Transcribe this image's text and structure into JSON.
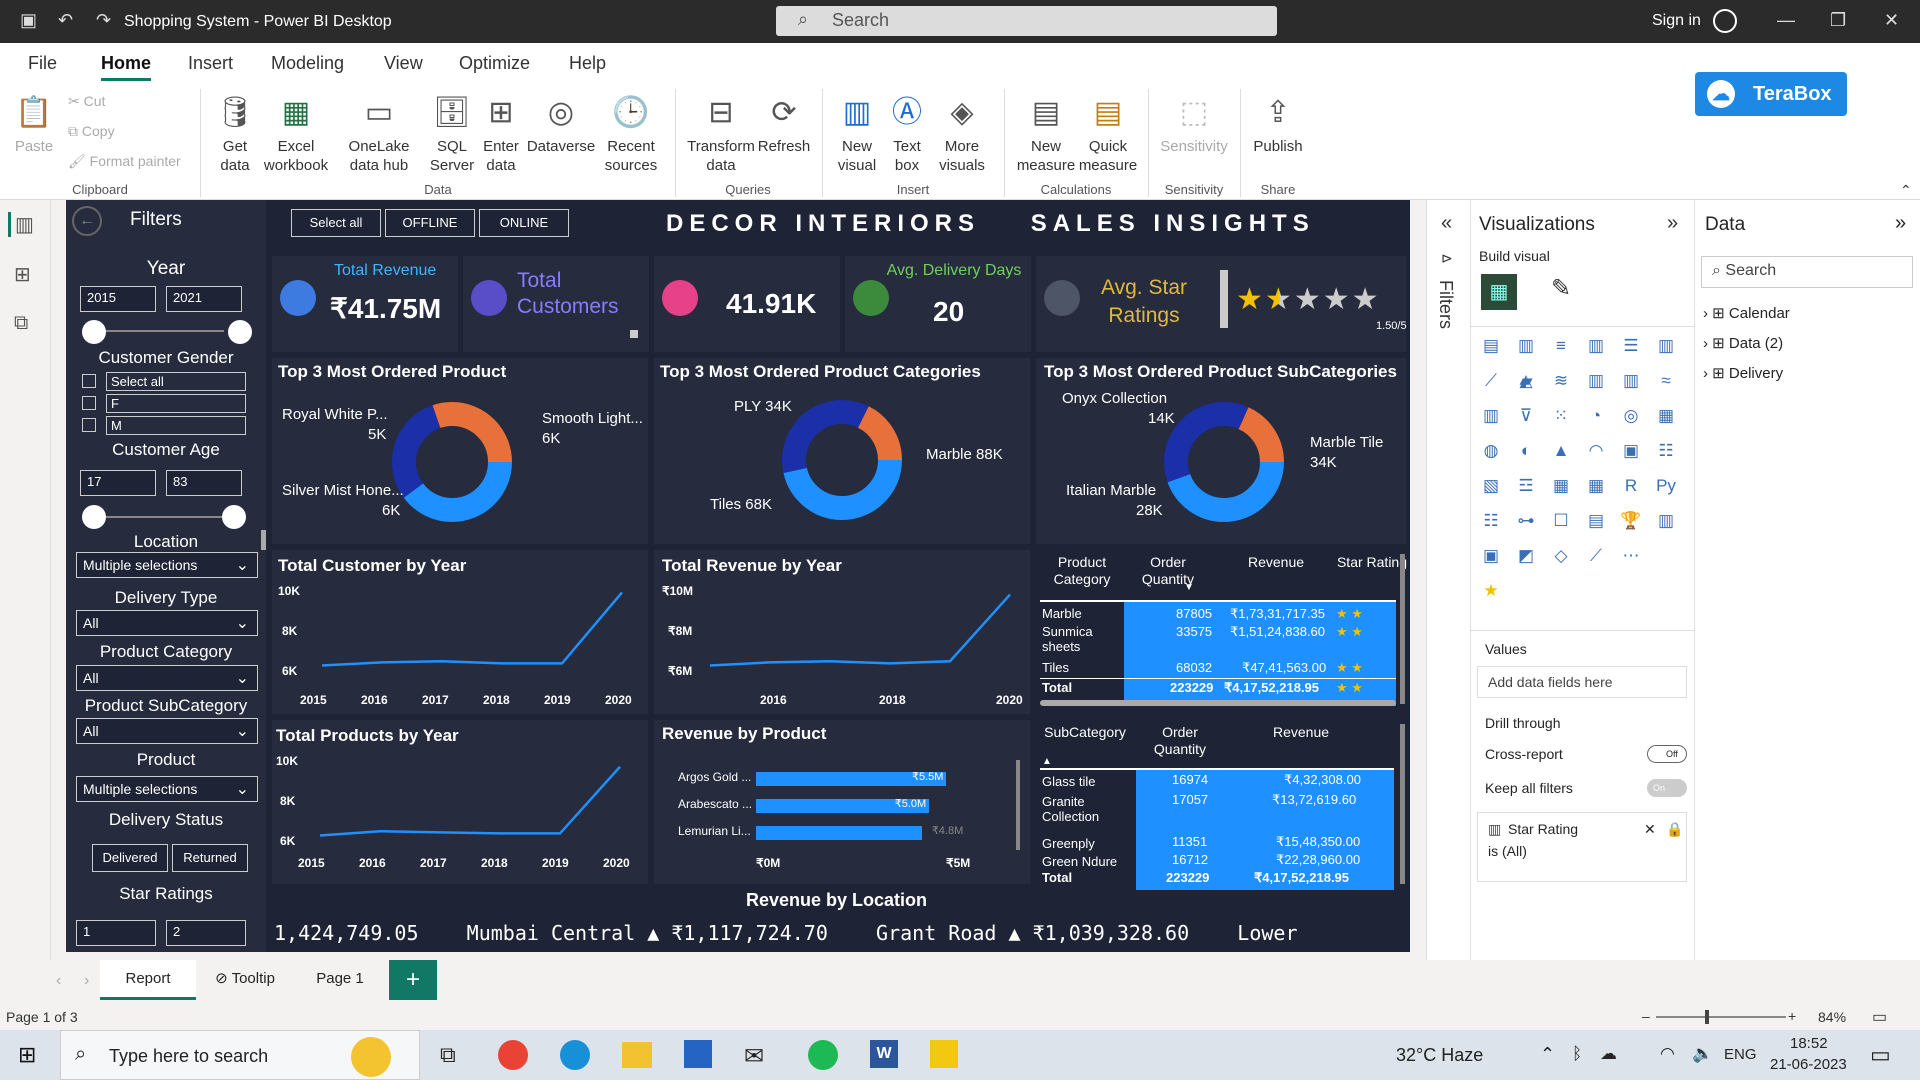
{
  "titlebar": {
    "title": "Shopping System - Power BI Desktop",
    "search_placeholder": "Search",
    "signin": "Sign in"
  },
  "menu": [
    "File",
    "Home",
    "Insert",
    "Modeling",
    "View",
    "Optimize",
    "Help"
  ],
  "ribbon": {
    "clipboard": {
      "paste": "Paste",
      "cut": "Cut",
      "copy": "Copy",
      "format_painter": "Format painter",
      "group": "Clipboard"
    },
    "data": {
      "get_data": "Get data",
      "excel": "Excel workbook",
      "onelake": "OneLake data hub",
      "sql": "SQL Server",
      "enter": "Enter data",
      "dataverse": "Dataverse",
      "recent": "Recent sources",
      "group": "Data"
    },
    "queries": {
      "transform": "Transform data",
      "refresh": "Refresh",
      "group": "Queries"
    },
    "insert": {
      "new_visual": "New visual",
      "text_box": "Text box",
      "more_visuals": "More visuals",
      "group": "Insert"
    },
    "calculations": {
      "new_measure": "New measure",
      "quick_measure": "Quick measure",
      "group": "Calculations"
    },
    "sensitivity": {
      "label": "Sensitivity",
      "group": "Sensitivity"
    },
    "share": {
      "publish": "Publish",
      "group": "Share"
    },
    "terabox": "TeraBox"
  },
  "report": {
    "filters_title": "Filters",
    "buttons": [
      "Select all",
      "OFFLINE",
      "ONLINE"
    ],
    "heading": "DECOR INTERIORS    SALES INSIGHTS",
    "slicers": {
      "year": {
        "label": "Year",
        "from": "2015",
        "to": "2021"
      },
      "gender": {
        "label": "Customer Gender",
        "options": [
          "Select all",
          "F",
          "M"
        ]
      },
      "age": {
        "label": "Customer Age",
        "from": "17",
        "to": "83"
      },
      "location": {
        "label": "Location",
        "value": "Multiple selections"
      },
      "delivery_type": {
        "label": "Delivery Type",
        "value": "All"
      },
      "product_category": {
        "label": "Product Category",
        "value": "All"
      },
      "product_subcategory": {
        "label": "Product SubCategory",
        "value": "All"
      },
      "product": {
        "label": "Product",
        "value": "Multiple selections"
      },
      "delivery_status": {
        "label": "Delivery Status",
        "options": [
          "Delivered",
          "Returned"
        ]
      },
      "star_ratings": {
        "label": "Star Ratings",
        "from": "1",
        "to": "2"
      }
    },
    "kpis": {
      "total_revenue": {
        "label": "Total Revenue",
        "value": "₹41.75M"
      },
      "total_customers": {
        "label": "Total Customers"
      },
      "customers_value": "41.91K",
      "avg_delivery": {
        "label": "Avg. Delivery Days",
        "value": "20"
      },
      "avg_star": {
        "label": "Avg. Star Ratings",
        "value": "1.50/5",
        "stars": [
          "★",
          "★",
          "★",
          "★",
          "★"
        ],
        "rating": 1.5
      }
    },
    "donuts": [
      {
        "title": "Top 3 Most Ordered Product",
        "labels": [
          {
            "name": "Royal White P...",
            "val": "5K"
          },
          {
            "name": "Smooth Light...",
            "val": "6K"
          },
          {
            "name": "Silver Mist Hone...",
            "val": "6K"
          }
        ]
      },
      {
        "title": "Top 3 Most Ordered Product Categories",
        "labels": [
          {
            "name": "PLY",
            "val": "34K"
          },
          {
            "name": "Marble",
            "val": "88K"
          },
          {
            "name": "Tiles",
            "val": "68K"
          }
        ]
      },
      {
        "title": "Top 3 Most Ordered Product SubCategories",
        "labels": [
          {
            "name": "Onyx Collection",
            "val": "14K"
          },
          {
            "name": "Marble Tile",
            "val": "34K"
          },
          {
            "name": "Italian Marble",
            "val": "28K"
          }
        ]
      }
    ],
    "line_charts": [
      {
        "title": "Total Customer by Year",
        "yticks": [
          "10K",
          "8K",
          "6K"
        ],
        "xticks": [
          "2015",
          "2016",
          "2017",
          "2018",
          "2019",
          "2020"
        ]
      },
      {
        "title": "Total Revenue by Year",
        "yticks": [
          "₹10M",
          "₹8M",
          "₹6M"
        ],
        "xticks": [
          "2016",
          "2018",
          "2020"
        ]
      },
      {
        "title": "Total Products by Year",
        "yticks": [
          "10K",
          "8K",
          "6K"
        ],
        "xticks": [
          "2015",
          "2016",
          "2017",
          "2018",
          "2019",
          "2020"
        ]
      }
    ],
    "bar_chart": {
      "title": "Revenue by Product",
      "categories": [
        "Argos Gold ...",
        "Arabescato ...",
        "Lemurian Li..."
      ],
      "value_labels": [
        "₹5.5M",
        "₹5.0M",
        "₹4.8M"
      ],
      "xticks": [
        "₹0M",
        "₹5M"
      ]
    },
    "table1": {
      "headers": [
        "Product Category",
        "Order Quantity",
        "Revenue",
        "Star Rating"
      ],
      "rows": [
        [
          "Marble",
          "87805",
          "₹1,73,31,717.35",
          "★ ★"
        ],
        [
          "Sunmica sheets",
          "33575",
          "₹1,51,24,838.60",
          "★ ★"
        ],
        [
          "Tiles",
          "68032",
          "₹47,41,563.00",
          "★ ★"
        ],
        [
          "Total",
          "223229",
          "₹4,17,52,218.95",
          "★ ★"
        ]
      ]
    },
    "table2": {
      "headers": [
        "SubCategory",
        "Order Quantity",
        "Revenue"
      ],
      "rows": [
        [
          "Glass tile",
          "16974",
          "₹4,32,308.00"
        ],
        [
          "Granite Collection",
          "17057",
          "₹13,72,619.60"
        ],
        [
          "Greenply",
          "11351",
          "₹15,48,350.00"
        ],
        [
          "Green Ndure",
          "16712",
          "₹22,28,960.00"
        ],
        [
          "Total",
          "223229",
          "₹4,17,52,218.95"
        ]
      ]
    },
    "ticker": {
      "title": "Revenue by Location",
      "text": "1,424,749.05    Mumbai Central ▲ ₹1,117,724.70    Grant Road ▲ ₹1,039,328.60    Lower"
    }
  },
  "chart_data": [
    {
      "type": "pie",
      "title": "Top 3 Most Ordered Product",
      "categories": [
        "Royal White P...",
        "Smooth Light...",
        "Silver Mist Hone..."
      ],
      "values": [
        5000,
        6000,
        6000
      ]
    },
    {
      "type": "pie",
      "title": "Top 3 Most Ordered Product Categories",
      "categories": [
        "PLY",
        "Marble",
        "Tiles"
      ],
      "values": [
        34000,
        88000,
        68000
      ]
    },
    {
      "type": "pie",
      "title": "Top 3 Most Ordered Product SubCategories",
      "categories": [
        "Onyx Collection",
        "Marble Tile",
        "Italian Marble"
      ],
      "values": [
        14000,
        34000,
        28000
      ]
    },
    {
      "type": "line",
      "title": "Total Customer by Year",
      "x": [
        2015,
        2016,
        2017,
        2018,
        2019,
        2020
      ],
      "values": [
        6300,
        6450,
        6500,
        6400,
        6400,
        9700
      ],
      "ylim": [
        6000,
        10000
      ]
    },
    {
      "type": "line",
      "title": "Total Revenue by Year",
      "x": [
        2015,
        2016,
        2017,
        2018,
        2019,
        2020
      ],
      "values": [
        6300,
        6450,
        6500,
        6400,
        6500,
        9600
      ],
      "ylim": [
        6000,
        10000
      ]
    },
    {
      "type": "line",
      "title": "Total Products by Year",
      "x": [
        2015,
        2016,
        2017,
        2018,
        2019,
        2020
      ],
      "values": [
        6300,
        6500,
        6450,
        6400,
        6400,
        9500
      ],
      "ylim": [
        6000,
        10000
      ]
    },
    {
      "type": "bar",
      "title": "Revenue by Product",
      "categories": [
        "Argos Gold ...",
        "Arabescato ...",
        "Lemurian Li..."
      ],
      "values": [
        5.5,
        5.0,
        4.8
      ],
      "xlim": [
        0,
        5.5
      ]
    }
  ],
  "visualizations": {
    "title": "Visualizations",
    "build": "Build visual",
    "values": "Values",
    "add_fields": "Add data fields here",
    "drill": "Drill through",
    "cross": "Cross-report",
    "cross_state": "Off",
    "keep": "Keep all filters",
    "keep_state": "On",
    "filter_card": "Star Rating",
    "filter_card_sub": "is (All)"
  },
  "data_pane": {
    "title": "Data",
    "search": "Search",
    "items": [
      "Calendar",
      "Data (2)",
      "Delivery"
    ]
  },
  "filters_tab": "Filters",
  "pages": {
    "tabs": [
      "Report",
      "Tooltip",
      "Page 1"
    ],
    "add": "+"
  },
  "status": {
    "page": "Page 1 of 3",
    "zoom": "84%"
  },
  "taskbar": {
    "search": "Type here to search",
    "weather": "32°C  Haze",
    "lang": "ENG",
    "time": "18:52",
    "date": "21-06-2023"
  },
  "colors": {
    "canvas": "#1e2336",
    "panel": "#262b3d",
    "accent": "#1e90ff",
    "orange": "#e8703a",
    "navy": "#1a2fa8"
  }
}
